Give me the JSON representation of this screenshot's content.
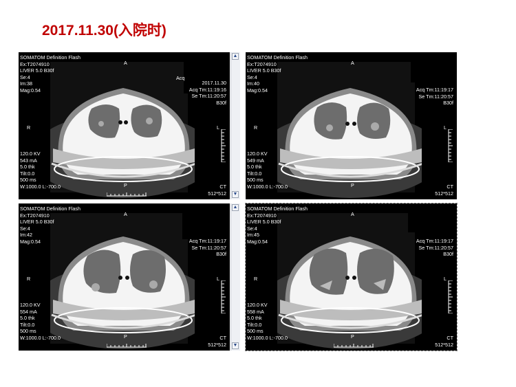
{
  "page_title": "2017.11.30(入院时)",
  "viewers": [
    {
      "id": "top-left",
      "header": [
        "SOMATOM Definition Flash",
        "Ex:T2074910",
        "LIVER  5.0  B30f",
        "Se:4",
        "Im:38",
        "Mag:0.54"
      ],
      "right_info": [
        "2017.11.30",
        "Acq Tm:11:19:16",
        "Se Tm:11:20:57",
        "B30f"
      ],
      "partial_text": "Acq",
      "orient_top": "A",
      "orient_left": "R",
      "orient_right": "L",
      "orient_bottom": "P",
      "params": [
        "120.0 KV",
        "543 mA",
        "5.0 thk",
        "Tilt:0.0",
        "500 ms",
        "W:1000.0 L:-700.0"
      ],
      "bottom_right": [
        "CT",
        "512*512"
      ]
    },
    {
      "id": "top-right",
      "header": [
        "SOMATOM Definition Flash",
        "Ex:T2074910",
        "LIVER  5.0  B30f",
        "Se:4",
        "Im:40",
        "Mag:0.54"
      ],
      "right_info": [
        "Acq Tm:11:19:17",
        "Se Tm:11:20:57",
        "B30f"
      ],
      "orient_top": "A",
      "orient_left": "R",
      "orient_right": "L",
      "orient_bottom": "P",
      "params": [
        "120.0 KV",
        "549 mA",
        "5.0 thk",
        "Tilt:0.0",
        "500 ms",
        "W:1000.0 L:-700.0"
      ],
      "bottom_right": [
        "CT",
        "512*512"
      ]
    },
    {
      "id": "bottom-left",
      "header": [
        "SOMATOM Definition Flash",
        "Ex:T2074910",
        "LIVER  5.0  B30f",
        "Se:4",
        "Im:42",
        "Mag:0.54"
      ],
      "right_info": [
        "Acq Tm:11:19:17",
        "Se Tm:11:20:57",
        "B30f"
      ],
      "orient_top": "A",
      "orient_left": "R",
      "orient_right": "L",
      "orient_bottom": "P",
      "params": [
        "120.0 KV",
        "554 mA",
        "5.0 thk",
        "Tilt:0.0",
        "500 ms",
        "W:1000.0 L:-700.0"
      ],
      "bottom_right": [
        "CT",
        "512*512"
      ]
    },
    {
      "id": "bottom-right",
      "header": [
        "SOMATOM Definition Flash",
        "Ex:T2074910",
        "LIVER  5.0  B30f",
        "Se:4",
        "Im:45",
        "Mag:0.54"
      ],
      "right_info": [
        "Acq Tm:11:19:17",
        "Se Tm:11:20:57",
        "B30f"
      ],
      "orient_top": "A",
      "orient_left": "R",
      "orient_right": "L",
      "orient_bottom": "P",
      "params": [
        "120.0 KV",
        "558 mA",
        "5.0 thk",
        "Tilt:0.0",
        "500 ms",
        "W:1000.0 L:-700.0"
      ],
      "bottom_right": [
        "CT",
        "512*512"
      ]
    }
  ],
  "scroll_up_icon": "triangle-up-icon",
  "scroll_down_icon": "triangle-down-icon",
  "colors": {
    "title": "#c00000",
    "viewer_bg": "#000000",
    "overlay_text": "#ffffff"
  }
}
